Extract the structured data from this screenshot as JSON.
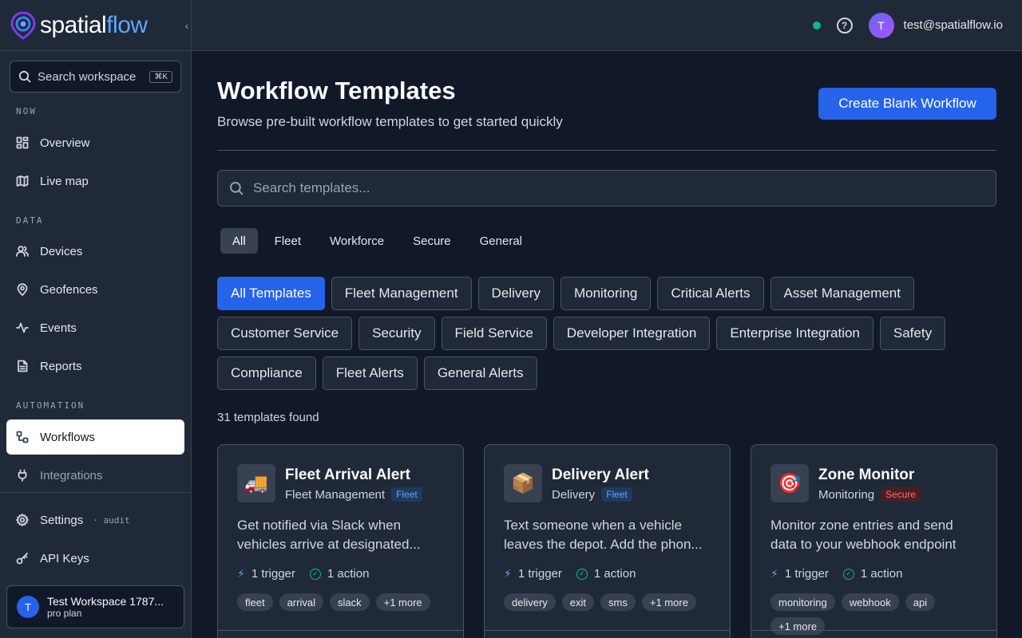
{
  "brand": {
    "name_main": "spatial",
    "name_accent": "flow"
  },
  "sidebar": {
    "search_placeholder": "Search workspace",
    "search_shortcut": "⌘K",
    "sections": {
      "now": "NOW",
      "data": "DATA",
      "automation": "AUTOMATION"
    },
    "items": [
      {
        "label": "Overview"
      },
      {
        "label": "Live map"
      },
      {
        "label": "Devices"
      },
      {
        "label": "Geofences"
      },
      {
        "label": "Events"
      },
      {
        "label": "Reports"
      },
      {
        "label": "Workflows"
      },
      {
        "label": "Integrations"
      },
      {
        "label": "Settings",
        "suffix": "· audit"
      },
      {
        "label": "API Keys"
      }
    ],
    "workspace": {
      "avatar": "T",
      "name": "Test Workspace 1787...",
      "plan": "pro plan"
    }
  },
  "header": {
    "user_avatar": "T",
    "user_email": "test@spatialflow.io",
    "help": "?",
    "status_color": "#10b981"
  },
  "main": {
    "title": "Workflow Templates",
    "subtitle": "Browse pre-built workflow templates to get started quickly",
    "create_button": "Create Blank Workflow",
    "search_placeholder": "Search templates...",
    "tabs": [
      "All",
      "Fleet",
      "Workforce",
      "Secure",
      "General"
    ],
    "categories": [
      "All Templates",
      "Fleet Management",
      "Delivery",
      "Monitoring",
      "Critical Alerts",
      "Asset Management",
      "Customer Service",
      "Security",
      "Field Service",
      "Developer Integration",
      "Enterprise Integration",
      "Safety",
      "Compliance",
      "Fleet Alerts",
      "General Alerts"
    ],
    "count": "31 templates found",
    "cards": [
      {
        "icon": "🚚",
        "title": "Fleet Arrival Alert",
        "category": "Fleet Management",
        "badge": "Fleet",
        "desc1": "Get notified via Slack when",
        "desc2": "vehicles arrive at designated...",
        "triggers": "1 trigger",
        "actions": "1 action",
        "tags": [
          "fleet",
          "arrival",
          "slack",
          "+1 more"
        ]
      },
      {
        "icon": "📦",
        "title": "Delivery Alert",
        "category": "Delivery",
        "badge": "Fleet",
        "desc1": "Text someone when a vehicle",
        "desc2": "leaves the depot. Add the phon...",
        "triggers": "1 trigger",
        "actions": "1 action",
        "tags": [
          "delivery",
          "exit",
          "sms",
          "+1 more"
        ]
      },
      {
        "icon": "🎯",
        "title": "Zone Monitor",
        "category": "Monitoring",
        "badge": "Secure",
        "desc1": "Monitor zone entries and send",
        "desc2": "data to your webhook endpoint",
        "triggers": "1 trigger",
        "actions": "1 action",
        "tags": [
          "monitoring",
          "webhook",
          "api",
          "+1 more"
        ]
      }
    ]
  }
}
